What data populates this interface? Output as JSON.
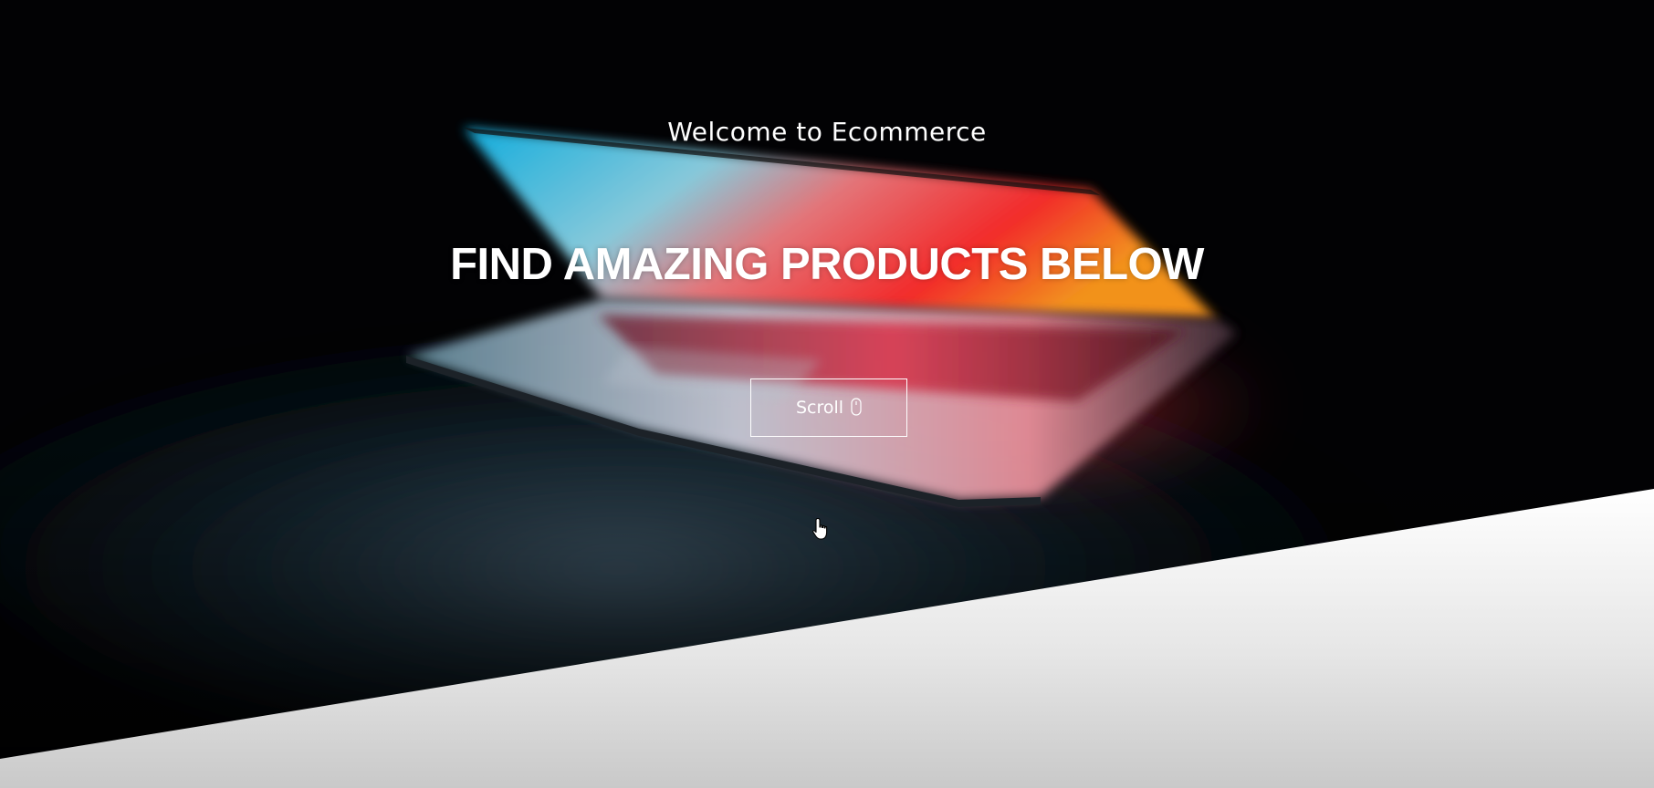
{
  "hero": {
    "welcome_text": "Welcome to Ecommerce",
    "headline": "FIND AMAZING PRODUCTS BELOW",
    "scroll_button": {
      "label": "Scroll",
      "icon": "mouse-icon"
    },
    "background_image": "laptop-photo",
    "cursor_icon": "hand-pointer-icon"
  },
  "colors": {
    "text": "#ffffff",
    "background": "#000000",
    "panel": "#e6e6e6",
    "screen_cyan": "#1aa8d8",
    "screen_red": "#e8242c",
    "screen_orange": "#ff8a1e"
  }
}
